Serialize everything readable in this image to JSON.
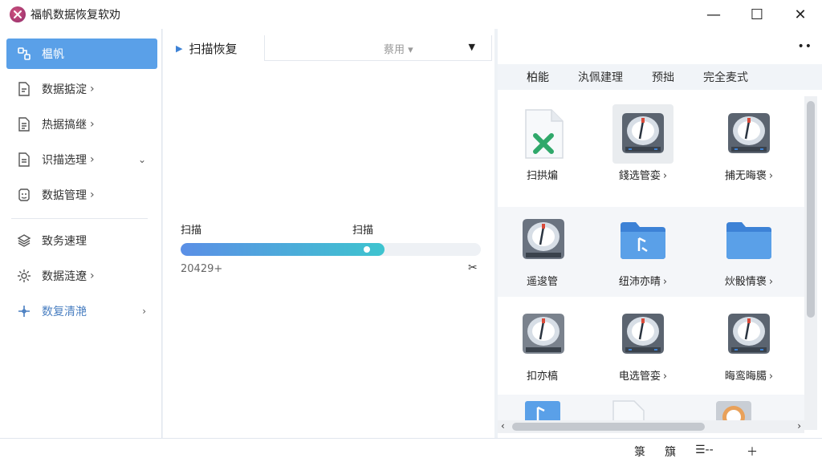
{
  "app": {
    "title": "福帆数据恢复软劝"
  },
  "window_controls": {
    "minimize": "—",
    "maximize": "☐",
    "close": "✕"
  },
  "sidebar": {
    "items": [
      {
        "label": "榅帆",
        "icon": "link-icon"
      },
      {
        "label": "数据掂淀",
        "icon": "document-icon"
      },
      {
        "label": "热据搞继",
        "icon": "document-list-icon"
      },
      {
        "label": "识描选理",
        "icon": "document-icon"
      },
      {
        "label": "数掂管理",
        "icon": "face-icon"
      },
      {
        "label": "致务速理",
        "icon": "layers-icon"
      },
      {
        "label": "数据涟遼",
        "icon": "gear-icon"
      },
      {
        "label": "数复清滟",
        "icon": "plus-icon"
      }
    ]
  },
  "middle": {
    "header": "扫描恢复",
    "dropdown_label": "蔡用",
    "scan_label_left": "扫描",
    "scan_label_right": "扫描",
    "progress_percent": 68,
    "scan_count": "20429+"
  },
  "right": {
    "tabs": [
      "柏能",
      "汍佩建理",
      "预拙",
      "完全麦式"
    ],
    "tiles": [
      {
        "label": "扫拱煸",
        "arrow": "",
        "icon": "spreadsheet-file-icon"
      },
      {
        "label": "錢选管娈",
        "arrow": "›",
        "icon": "hard-drive-icon"
      },
      {
        "label": "捕无晦褒",
        "arrow": "›",
        "icon": "hard-drive-icon"
      },
      {
        "label": "遥逡管",
        "arrow": "",
        "icon": "hard-drive-icon"
      },
      {
        "label": "纽沛亦晴",
        "arrow": "›",
        "icon": "folder-icon"
      },
      {
        "label": "炏骰情褒",
        "arrow": "›",
        "icon": "folder-icon"
      },
      {
        "label": "扣亦槁",
        "arrow": "",
        "icon": "hard-drive-icon"
      },
      {
        "label": "电选管娈",
        "arrow": "›",
        "icon": "hard-drive-icon"
      },
      {
        "label": "晦鸾晦臈",
        "arrow": "›",
        "icon": "hard-drive-icon"
      }
    ]
  },
  "statusbar": {
    "item1": "箓",
    "item2": "簱",
    "item3": "☰--",
    "item4": "＋"
  },
  "colors": {
    "accent": "#5aa0e8",
    "progress_start": "#5b8fe6",
    "progress_end": "#3ec4cf"
  }
}
